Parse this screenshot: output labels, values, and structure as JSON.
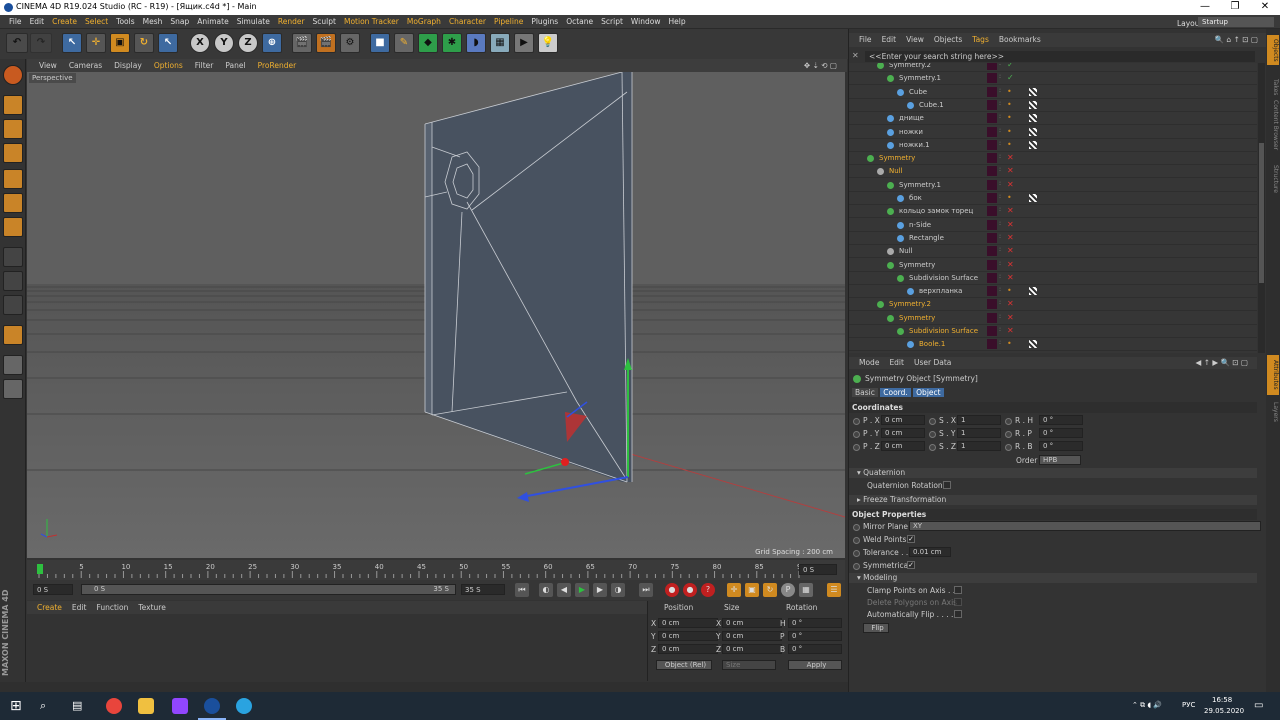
{
  "window": {
    "title": "CINEMA 4D R19.024 Studio (RC - R19) - [Ящик.c4d *] - Main"
  },
  "menu": [
    "File",
    "Edit",
    "Create",
    "Select",
    "Tools",
    "Mesh",
    "Snap",
    "Animate",
    "Simulate",
    "Render",
    "Sculpt",
    "Motion Tracker",
    "MoGraph",
    "Character",
    "Pipeline",
    "Plugins",
    "Octane",
    "Script",
    "Window",
    "Help"
  ],
  "menu_highlight": [
    "Create",
    "Select",
    "Render",
    "Motion Tracker",
    "MoGraph",
    "Character",
    "Pipeline"
  ],
  "layout": {
    "label": "Layout:",
    "value": "Startup"
  },
  "viewport": {
    "menu": [
      "View",
      "Cameras",
      "Display",
      "Options",
      "Filter",
      "Panel",
      "ProRender"
    ],
    "label": "Perspective",
    "grid_spacing": "Grid Spacing : 200 cm"
  },
  "timeline": {
    "ticks": [
      "0",
      "5",
      "10",
      "15",
      "20",
      "25",
      "30",
      "35",
      "40",
      "45",
      "50",
      "55",
      "60",
      "65",
      "70",
      "75",
      "80",
      "85",
      "90"
    ],
    "frame_field": "0 S"
  },
  "transport": {
    "start": "0 S",
    "range_left": "0 S",
    "range_right": "35 S",
    "end": "35 S"
  },
  "material": {
    "menu": [
      "Create",
      "Edit",
      "Function",
      "Texture"
    ]
  },
  "maxon": "MAXON CINEMA 4D",
  "coords": {
    "headers": [
      "Position",
      "Size",
      "Rotation"
    ],
    "rows": [
      {
        "a": "X",
        "pos": "0 cm",
        "b": "X",
        "size": "0 cm",
        "c": "H",
        "rot": "0 °"
      },
      {
        "a": "Y",
        "pos": "0 cm",
        "b": "Y",
        "size": "0 cm",
        "c": "P",
        "rot": "0 °"
      },
      {
        "a": "Z",
        "pos": "0 cm",
        "b": "Z",
        "size": "0 cm",
        "c": "B",
        "rot": "0 °"
      }
    ],
    "mode": "Object (Rel)",
    "size_mode": "Size",
    "apply": "Apply"
  },
  "objects": {
    "menu": [
      "File",
      "Edit",
      "View",
      "Objects",
      "Tags",
      "Bookmarks"
    ],
    "search_placeholder": "<<Enter your search string here>>",
    "rows": [
      {
        "name": "Symmetry.2",
        "indent": 18,
        "icon": "#4caf50",
        "tag": "✓"
      },
      {
        "name": "Symmetry.1",
        "indent": 28,
        "icon": "#4caf50",
        "tag": "✓"
      },
      {
        "name": "Cube",
        "indent": 38,
        "icon": "#5aa0e0",
        "tag": "•"
      },
      {
        "name": "Cube.1",
        "indent": 48,
        "icon": "#5aa0e0",
        "tag": "•"
      },
      {
        "name": "днище",
        "indent": 28,
        "icon": "#5aa0e0",
        "tag": "•"
      },
      {
        "name": "ножки",
        "indent": 28,
        "icon": "#5aa0e0",
        "tag": "•"
      },
      {
        "name": "ножки.1",
        "indent": 28,
        "icon": "#5aa0e0",
        "tag": "•"
      },
      {
        "name": "Symmetry",
        "indent": 8,
        "icon": "#4caf50",
        "tag": "✕",
        "sel": true
      },
      {
        "name": "Null",
        "indent": 18,
        "icon": "#aaa",
        "tag": "✕",
        "sel": true
      },
      {
        "name": "Symmetry.1",
        "indent": 28,
        "icon": "#4caf50",
        "tag": "✕"
      },
      {
        "name": "бок",
        "indent": 38,
        "icon": "#5aa0e0",
        "tag": "•"
      },
      {
        "name": "кольцо замок торец",
        "indent": 28,
        "icon": "#4caf50",
        "tag": "✕"
      },
      {
        "name": "n-Side",
        "indent": 38,
        "icon": "#5aa0e0",
        "tag": "✕"
      },
      {
        "name": "Rectangle",
        "indent": 38,
        "icon": "#5aa0e0",
        "tag": "✕"
      },
      {
        "name": "Null",
        "indent": 28,
        "icon": "#aaa",
        "tag": "✕"
      },
      {
        "name": "Symmetry",
        "indent": 28,
        "icon": "#4caf50",
        "tag": "✕"
      },
      {
        "name": "Subdivision Surface",
        "indent": 38,
        "icon": "#4caf50",
        "tag": "✕"
      },
      {
        "name": "верхпланка",
        "indent": 48,
        "icon": "#5aa0e0",
        "tag": "•"
      },
      {
        "name": "Symmetry.2",
        "indent": 18,
        "icon": "#4caf50",
        "tag": "✕",
        "sel": true
      },
      {
        "name": "Symmetry",
        "indent": 28,
        "icon": "#4caf50",
        "tag": "✕",
        "sel": true
      },
      {
        "name": "Subdivision Surface",
        "indent": 38,
        "icon": "#4caf50",
        "tag": "✕",
        "sel": true
      },
      {
        "name": "Boole.1",
        "indent": 48,
        "icon": "#5aa0e0",
        "tag": "•",
        "sel": true
      }
    ]
  },
  "attributes": {
    "menu": [
      "Mode",
      "Edit",
      "User Data"
    ],
    "object_title": "Symmetry Object [Symmetry]",
    "tabs": [
      "Basic",
      "Coord.",
      "Object"
    ],
    "coordinates_label": "Coordinates",
    "coord_rows": [
      {
        "p": "P . X",
        "pv": "0 cm",
        "s": "S . X",
        "sv": "1",
        "r": "R . H",
        "rv": "0 °"
      },
      {
        "p": "P . Y",
        "pv": "0 cm",
        "s": "S . Y",
        "sv": "1",
        "r": "R . P",
        "rv": "0 °"
      },
      {
        "p": "P . Z",
        "pv": "0 cm",
        "s": "S . Z",
        "sv": "1",
        "r": "R . B",
        "rv": "0 °"
      }
    ],
    "order_label": "Order",
    "order_value": "HPB",
    "quaternion": "Quaternion",
    "quaternion_rotation": "Quaternion Rotation",
    "freeze": "Freeze Transformation",
    "object_properties": "Object Properties",
    "mirror_plane": "Mirror Plane",
    "mirror_value": "XY",
    "weld_points": "Weld Points",
    "tolerance": "Tolerance . .",
    "tolerance_value": "0.01 cm",
    "symmetrical": "Symmetrical",
    "modeling": "Modeling",
    "clamp": "Clamp Points on Axis . .",
    "delete_polys": "Delete Polygons on Axis",
    "auto_flip": "Automatically Flip . . . . .",
    "flip": "Flip"
  },
  "side_tabs": [
    "Objects",
    "Takes",
    "Content Browser",
    "Structure"
  ],
  "attr_side_tabs": [
    "Attributes",
    "Layers"
  ],
  "taskbar": {
    "lang": "РУС",
    "time": "16:58",
    "date": "29.05.2020"
  }
}
